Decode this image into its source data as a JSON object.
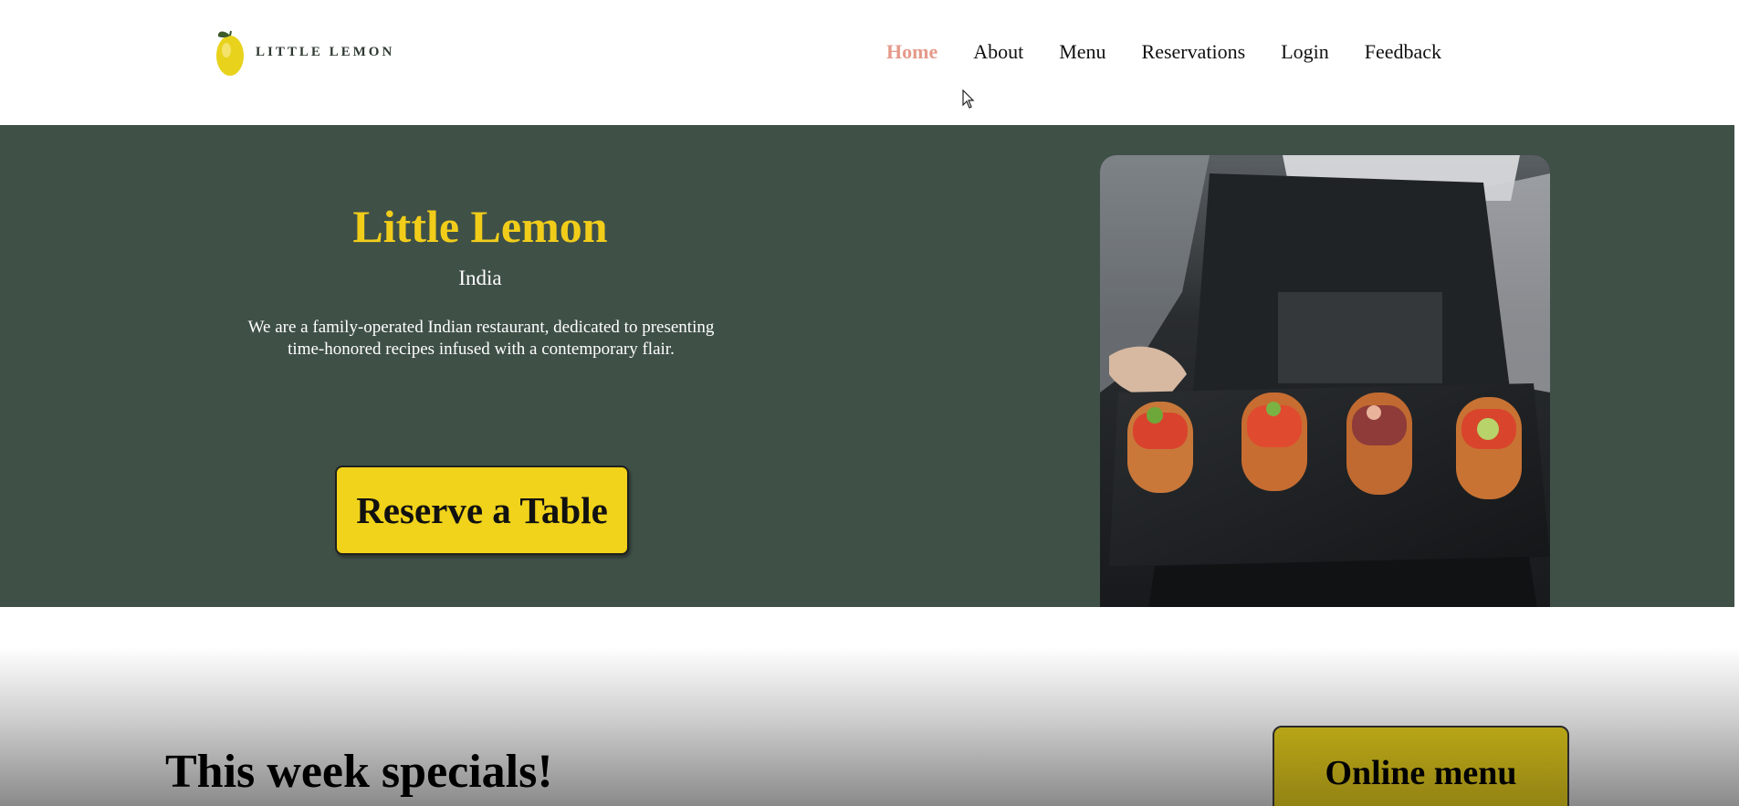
{
  "header": {
    "logo_text": "LITTLE LEMON",
    "nav": [
      {
        "label": "Home",
        "active": true
      },
      {
        "label": "About",
        "active": false
      },
      {
        "label": "Menu",
        "active": false
      },
      {
        "label": "Reservations",
        "active": false
      },
      {
        "label": "Login",
        "active": false
      },
      {
        "label": "Feedback",
        "active": false
      }
    ]
  },
  "hero": {
    "title": "Little Lemon",
    "subtitle": "India",
    "description": "We are a family-operated Indian restaurant, dedicated to presenting time-honored recipes infused with a contemporary flair.",
    "reserve_button": "Reserve a Table",
    "image_icon": "food-platter-photo"
  },
  "specials": {
    "title": "This week specials!",
    "online_menu_button": "Online menu"
  },
  "colors": {
    "brand_yellow": "#f1cd1a",
    "hero_green": "#3f5047",
    "active_nav": "#e59a8a"
  }
}
